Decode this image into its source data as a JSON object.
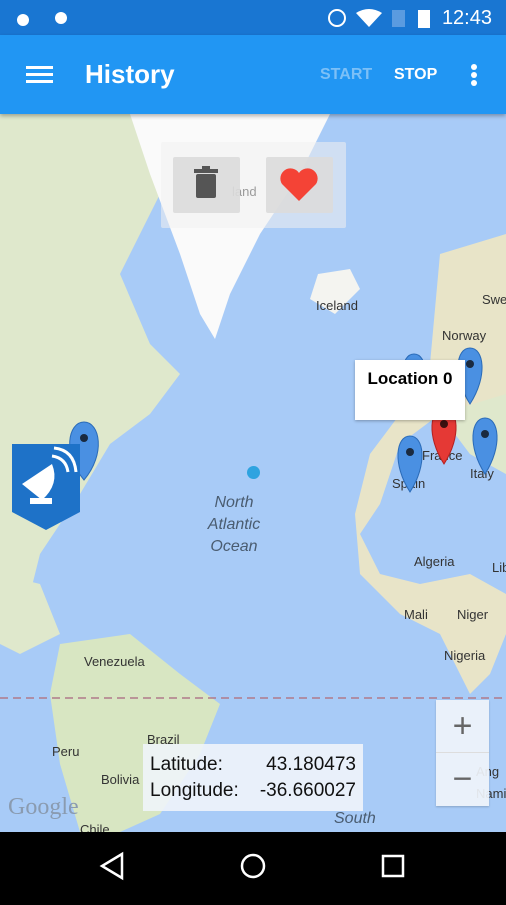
{
  "status_bar": {
    "time": "12:43"
  },
  "app_bar": {
    "title": "History",
    "start_label": "START",
    "stop_label": "STOP"
  },
  "map": {
    "labels": {
      "greenland": "land",
      "iceland": "Iceland",
      "norway": "Norway",
      "sweden": "Swe",
      "france": "France",
      "spain": "Spain",
      "italy": "Italy",
      "algeria": "Algeria",
      "libya": "Lib",
      "mali": "Mali",
      "niger": "Niger",
      "nigeria": "Nigeria",
      "venezuela": "Venezuela",
      "brazil": "Brazil",
      "peru": "Peru",
      "bolivia": "Bolivia",
      "chile": "Chile",
      "angola": "Ang",
      "namibia": "Nami",
      "south": "South"
    },
    "ocean_lines": [
      "North",
      "Atlantic",
      "Ocean"
    ],
    "popup": "Location 0",
    "google": "Google",
    "marker_color": "#4a90e2",
    "selected_marker_color": "#e53935"
  },
  "coords": {
    "lat_label": "Latitude:",
    "lat": "43.180473",
    "lon_label": "Longitude:",
    "lon": "-36.660027"
  },
  "zoom": {
    "in": "+",
    "out": "−"
  }
}
